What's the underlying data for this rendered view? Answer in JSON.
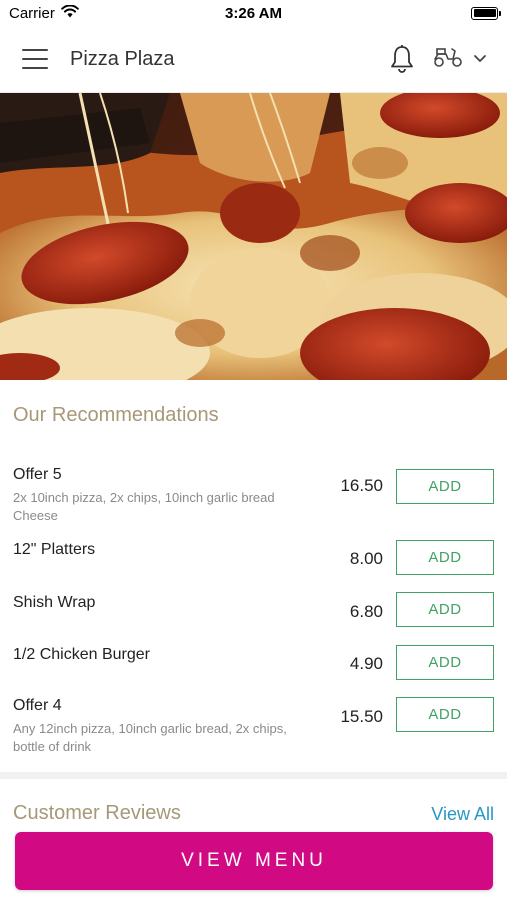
{
  "status_bar": {
    "carrier": "Carrier",
    "time": "3:26 AM"
  },
  "header": {
    "title": "Pizza Plaza"
  },
  "hero": {
    "image": "pepperoni-pizza-photo"
  },
  "recommendations": {
    "title": "Our Recommendations",
    "add_label": "ADD",
    "items": [
      {
        "name": "Offer 5",
        "description": "2x 10inch pizza, 2x chips, 10inch garlic bread Cheese",
        "price": "16.50",
        "add_label": "ADD"
      },
      {
        "name": "12\" Platters",
        "description": "",
        "price": "8.00",
        "add_label": "ADD"
      },
      {
        "name": "Shish Wrap",
        "description": "",
        "price": "6.80",
        "add_label": "ADD"
      },
      {
        "name": "1/2 Chicken Burger",
        "description": "",
        "price": "4.90",
        "add_label": "ADD"
      },
      {
        "name": "Offer 4",
        "description": "Any 12inch pizza, 10inch garlic bread, 2x chips, bottle of drink",
        "price": "15.50",
        "add_label": "ADD"
      }
    ]
  },
  "reviews": {
    "title": "Customer Reviews",
    "view_all": "View All"
  },
  "footer": {
    "view_menu_label": "VIEW MENU"
  },
  "colors": {
    "accent": "#d10a84",
    "add_green": "#3fa364",
    "section_title": "#a69878",
    "link_blue": "#2896c8"
  }
}
